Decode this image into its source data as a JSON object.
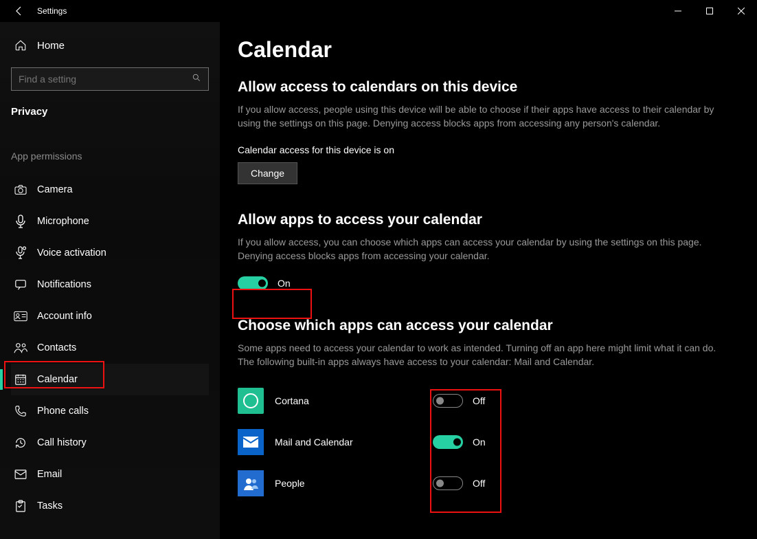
{
  "window": {
    "title": "Settings"
  },
  "nav": {
    "home": "Home",
    "search_placeholder": "Find a setting",
    "section": "Privacy",
    "group": "App permissions",
    "items": [
      {
        "id": "camera",
        "label": "Camera"
      },
      {
        "id": "microphone",
        "label": "Microphone"
      },
      {
        "id": "voice-activation",
        "label": "Voice activation"
      },
      {
        "id": "notifications",
        "label": "Notifications"
      },
      {
        "id": "account-info",
        "label": "Account info"
      },
      {
        "id": "contacts",
        "label": "Contacts"
      },
      {
        "id": "calendar",
        "label": "Calendar",
        "active": true
      },
      {
        "id": "phone-calls",
        "label": "Phone calls"
      },
      {
        "id": "call-history",
        "label": "Call history"
      },
      {
        "id": "email",
        "label": "Email"
      },
      {
        "id": "tasks",
        "label": "Tasks"
      }
    ]
  },
  "page": {
    "title": "Calendar",
    "device_access": {
      "heading": "Allow access to calendars on this device",
      "desc": "If you allow access, people using this device will be able to choose if their apps have access to their calendar by using the settings on this page. Denying access blocks apps from accessing any person's calendar.",
      "status": "Calendar access for this device is on",
      "button": "Change"
    },
    "app_access": {
      "heading": "Allow apps to access your calendar",
      "desc": "If you allow access, you can choose which apps can access your calendar by using the settings on this page. Denying access blocks apps from accessing your calendar.",
      "toggle_state": "on",
      "toggle_label": "On"
    },
    "choose_apps": {
      "heading": "Choose which apps can access your calendar",
      "desc": "Some apps need to access your calendar to work as intended. Turning off an app here might limit what it can do. The following built-in apps always have access to your calendar: Mail and Calendar.",
      "apps": [
        {
          "id": "cortana",
          "name": "Cortana",
          "state": "off",
          "label": "Off"
        },
        {
          "id": "mailcal",
          "name": "Mail and Calendar",
          "state": "on",
          "label": "On"
        },
        {
          "id": "people",
          "name": "People",
          "state": "off",
          "label": "Off"
        }
      ]
    }
  }
}
